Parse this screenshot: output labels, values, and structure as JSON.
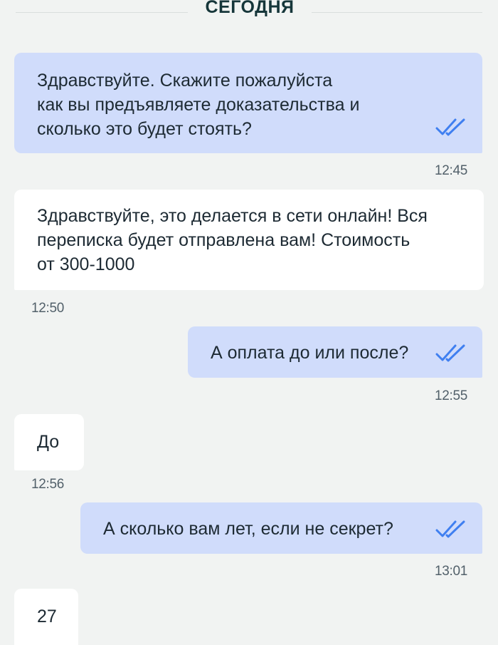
{
  "date_separator": "СЕГОДНЯ",
  "colors": {
    "outgoing": "#d0dcfb",
    "incoming": "#ffffff",
    "check": "#3f7ff0",
    "background": "#f1f3f2"
  },
  "messages": [
    {
      "direction": "outgoing",
      "text": "Здравствуйте. Скажите пожалуйста\nкак вы предъявляете доказательства и\nсколько это будет стоять?",
      "time": "12:45",
      "status_icon": "double-check-icon"
    },
    {
      "direction": "incoming",
      "text": "Здравствуйте, это делается в сети онлайн! Вся\nпереписка будет отправлена вам! Стоимость\nот 300-1000",
      "time": "12:50"
    },
    {
      "direction": "outgoing",
      "text": "А оплата до или после?",
      "time": "12:55",
      "status_icon": "double-check-icon"
    },
    {
      "direction": "incoming",
      "text": "До",
      "time": "12:56"
    },
    {
      "direction": "outgoing",
      "text": "А сколько вам лет, если не секрет?",
      "time": "13:01",
      "status_icon": "double-check-icon"
    },
    {
      "direction": "incoming",
      "text": "27",
      "time": ""
    }
  ]
}
